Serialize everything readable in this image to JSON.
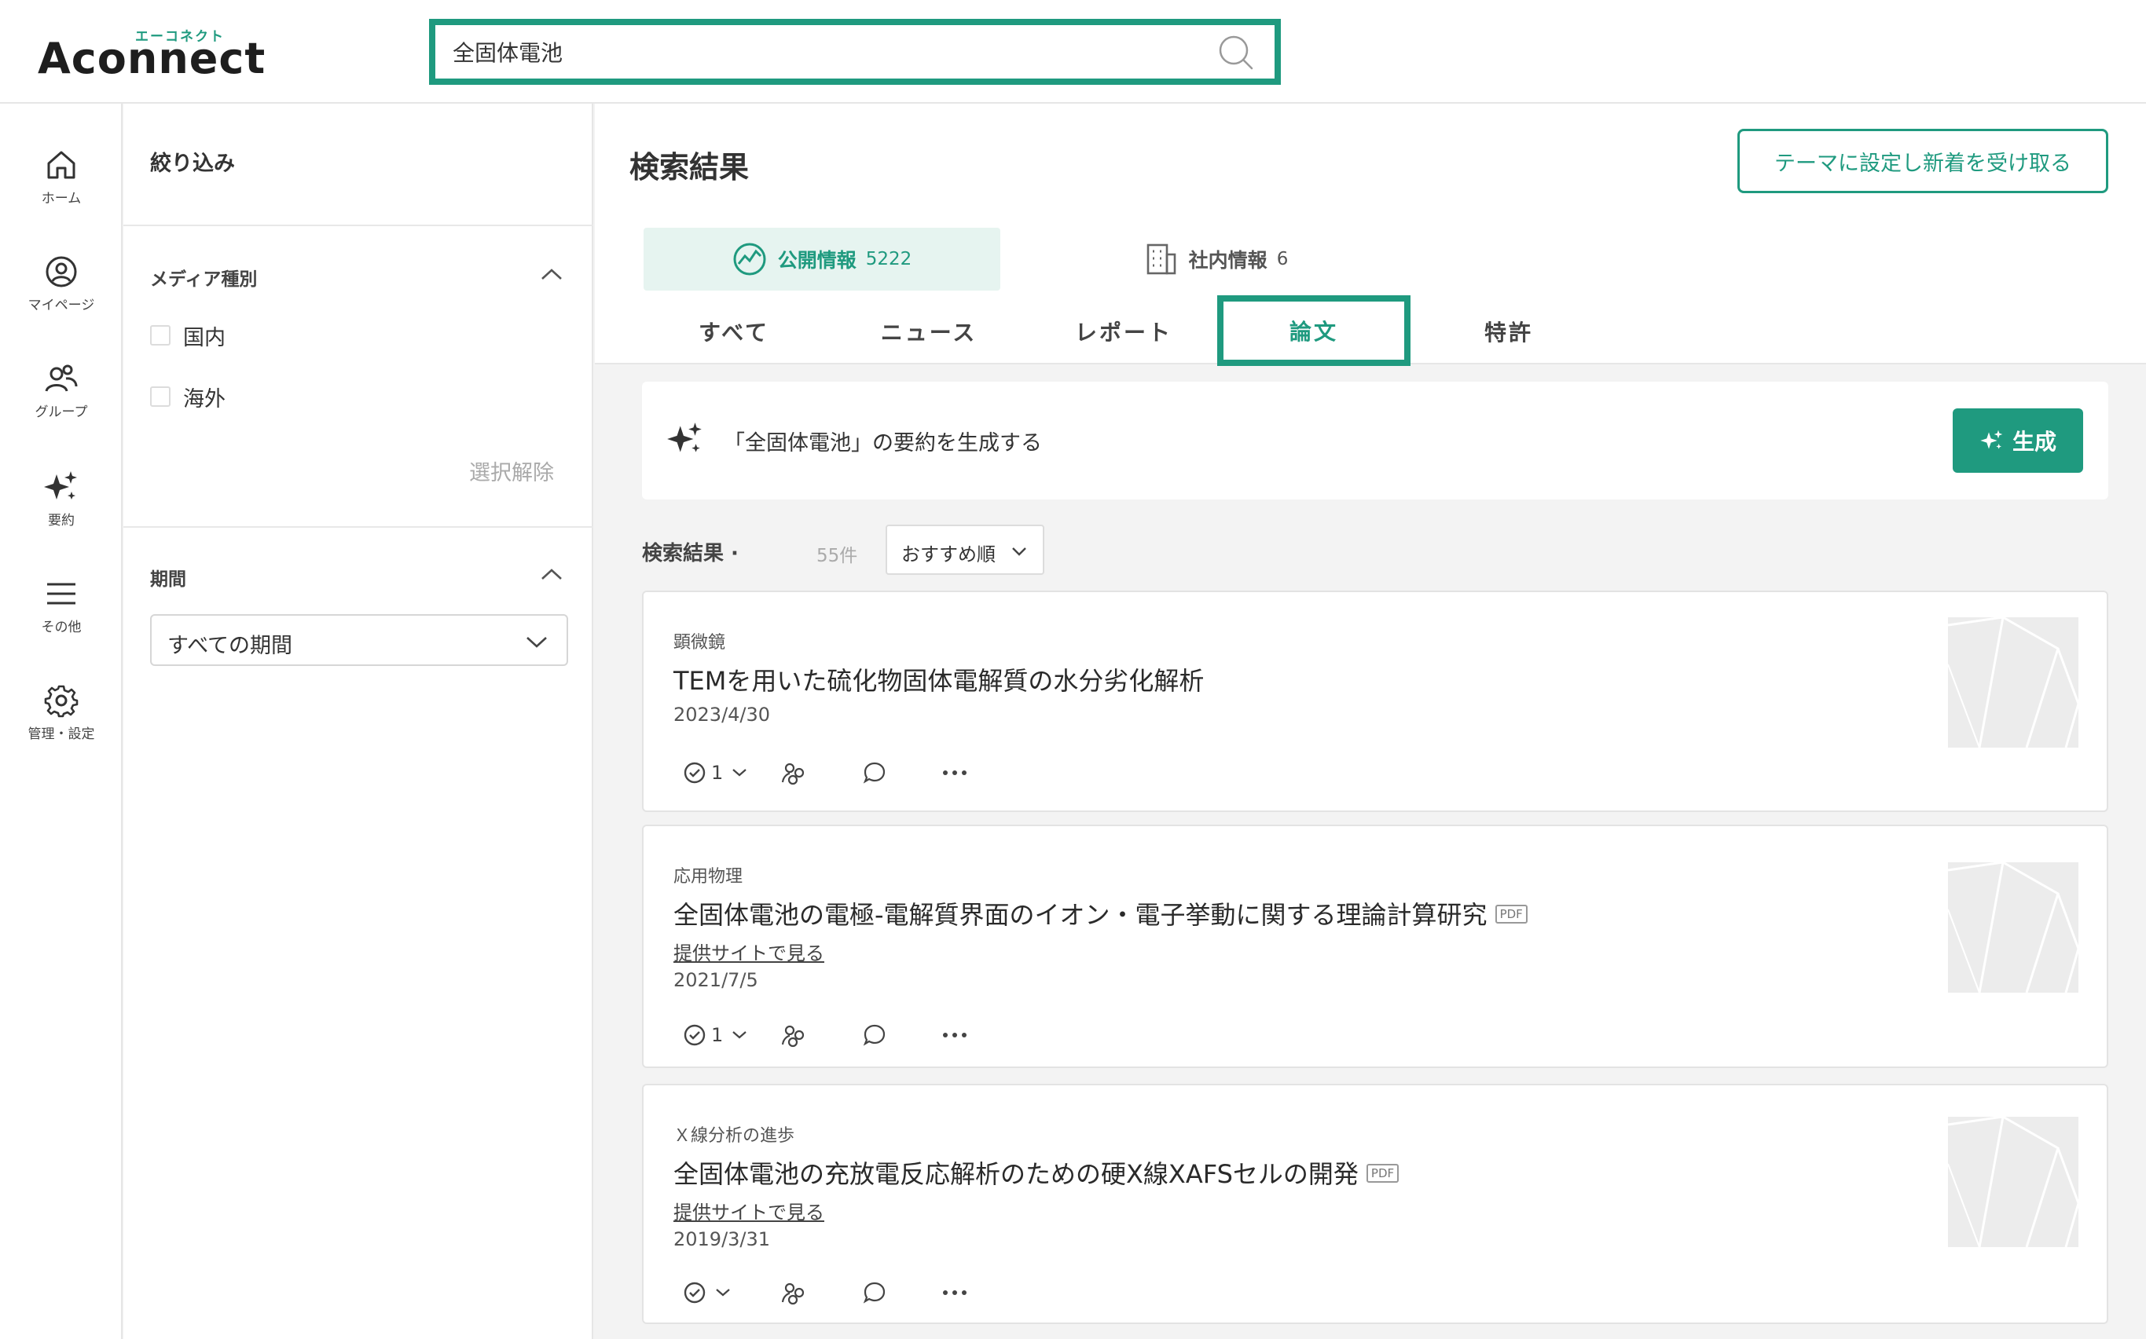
{
  "header": {
    "logo_ruby": "エーコネクト",
    "logo_text": "Aconnect",
    "search_value": "全固体電池"
  },
  "rail": {
    "items": [
      {
        "label": "ホーム",
        "icon": "home-icon"
      },
      {
        "label": "マイページ",
        "icon": "user-icon"
      },
      {
        "label": "グループ",
        "icon": "group-icon"
      },
      {
        "label": "要約",
        "icon": "sparkle-icon"
      },
      {
        "label": "その他",
        "icon": "menu-icon"
      },
      {
        "label": "管理・設定",
        "icon": "gear-icon"
      }
    ]
  },
  "filter": {
    "title": "絞り込み",
    "media_section": "メディア種別",
    "media_options": [
      "国内",
      "海外"
    ],
    "clear_label": "選択解除",
    "period_section": "期間",
    "period_value": "すべての期間"
  },
  "main": {
    "title": "検索結果",
    "theme_button": "テーマに設定し新着を受け取る",
    "source_tabs": [
      {
        "label": "公開情報",
        "count": "5222",
        "icon": "globe-chart-icon"
      },
      {
        "label": "社内情報",
        "count": "6",
        "icon": "building-icon"
      }
    ],
    "type_tabs": [
      "すべて",
      "ニュース",
      "レポート",
      "論文",
      "特許"
    ],
    "summary_text": "「全固体電池」の要約を生成する",
    "generate_label": "生成",
    "results_label": "検索結果 ·",
    "results_count": "55件",
    "sort_value": "おすすめ順"
  },
  "results": [
    {
      "category": "顕微鏡",
      "title": "TEMを用いた硫化物固体電解質の水分劣化解析",
      "pdf": "",
      "link": "",
      "date": "2023/4/30",
      "check_count": "1"
    },
    {
      "category": "応用物理",
      "title": "全固体電池の電極-電解質界面のイオン・電子挙動に関する理論計算研究",
      "pdf": "PDF",
      "link": "提供サイトで見る",
      "date": "2021/7/5",
      "check_count": "1"
    },
    {
      "category": "Ｘ線分析の進歩",
      "title": "全固体電池の充放電反応解析のための硬X線XAFSセルの開発",
      "pdf": "PDF",
      "link": "提供サイトで見る",
      "date": "2019/3/31",
      "check_count": ""
    }
  ],
  "colors": {
    "accent": "#1f9a7f",
    "accent_light": "#e6f4f0",
    "background": "#f3f3f3"
  }
}
